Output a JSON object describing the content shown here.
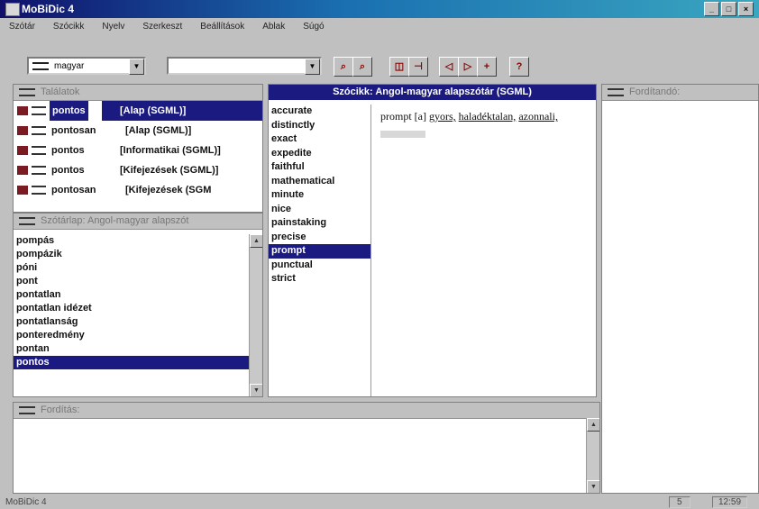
{
  "window": {
    "title": "MoBiDic 4"
  },
  "menu": [
    "Szótár",
    "Szócikk",
    "Nyelv",
    "Szerkeszt",
    "Beállítások",
    "Ablak",
    "Súgó"
  ],
  "toolbar": {
    "language": "magyar",
    "search_value": ""
  },
  "matches_panel": {
    "title": "Találatok",
    "items": [
      {
        "word": "pontos",
        "source": "[Alap (SGML)]",
        "selected": true
      },
      {
        "word": "pontosan",
        "source": "[Alap (SGML)]",
        "selected": false
      },
      {
        "word": "pontos",
        "source": "[Informatikai (SGML)]",
        "selected": false
      },
      {
        "word": "pontos",
        "source": "[Kifejezések (SGML)]",
        "selected": false
      },
      {
        "word": "pontosan",
        "source": "[Kifejezések (SGM",
        "selected": false
      }
    ]
  },
  "wordlist_panel": {
    "title": "Szótárlap: Angol-magyar alapszót",
    "items": [
      "pompás",
      "pompázik",
      "póni",
      "pont",
      "pontatlan",
      "pontatlan idézet",
      "pontatlanság",
      "ponteredmény",
      "pontan",
      "pontos"
    ],
    "selected": "pontos"
  },
  "article_panel": {
    "title": "Szócikk: Angol-magyar alapszótár (SGML)",
    "words": [
      "accurate",
      "distinctly",
      "exact",
      "expedite",
      "faithful",
      "mathematical",
      "minute",
      "nice",
      "painstaking",
      "precise",
      "prompt",
      "punctual",
      "strict"
    ],
    "selected": "prompt",
    "definition_head": "prompt",
    "definition_tag": "[a]",
    "definition_terms": [
      "gyors,",
      "haladéktalan,",
      "azonnali,"
    ]
  },
  "translate_panel": {
    "title": "Fordítandó:"
  },
  "translation_panel": {
    "title": "Fordítás:"
  },
  "status": {
    "left": "MoBiDic 4",
    "page": "5",
    "time": "12:59"
  }
}
